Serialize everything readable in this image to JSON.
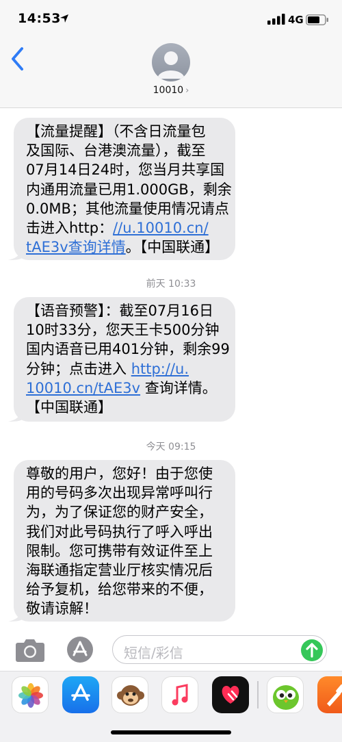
{
  "status": {
    "time": "14:53",
    "network": "4G"
  },
  "header": {
    "contact": "10010",
    "chevron": "›"
  },
  "messages": [
    {
      "lines": [
        "【流量提醒】（不含日流量包",
        "及国际、台港澳流量），截至",
        "07月14日24时，您当月共享国",
        "内通用流量已用1.000GB，剩余",
        "0.0MB；其他流量使用情况请点"
      ],
      "l6_text": "击进入http：",
      "l6_link": "//u.10010.cn/",
      "l7_link": "tAE3v查询详情",
      "l7_text": "。【中国联通】"
    },
    {
      "timestamp": "前天 10:33",
      "lines": [
        "【语音预警】：截至07月16日",
        "10时33分，您天王卡500分钟",
        "国内语音已用401分钟，剩余99"
      ],
      "l4_text": "分钟；点击进入 ",
      "l4_link": "http://u.",
      "l5_link": "10010.cn/tAE3v",
      "l5_text": " 查询详情。",
      "l6_text": "【中国联通】"
    },
    {
      "timestamp": "今天 09:15",
      "lines": [
        "尊敬的用户，您好！由于您使",
        "用的号码多次出现异常呼叫行",
        "为，为了保证您的财产安全，",
        "我们对此号码执行了呼入呼出",
        "限制。您可携带有效证件至上",
        "海联通指定营业厅核实情况后",
        "给予复机，给您带来的不便，",
        "敬请谅解！"
      ]
    }
  ],
  "input": {
    "placeholder": "短信/彩信"
  },
  "icons": [
    "location-arrow-icon",
    "signal-icon",
    "battery-icon",
    "back-chevron-icon",
    "contact-avatar-icon",
    "camera-icon",
    "app-store-icon",
    "send-arrow-icon",
    "photos-app-icon",
    "appstore-app-icon",
    "animoji-app-icon",
    "music-app-icon",
    "digital-touch-app-icon",
    "duolingo-app-icon",
    "garageband-app-icon"
  ],
  "colors": {
    "link": "#2e6fd6",
    "bubble": "#e9e9eb",
    "send": "#35c759",
    "back": "#2f7cf6"
  }
}
